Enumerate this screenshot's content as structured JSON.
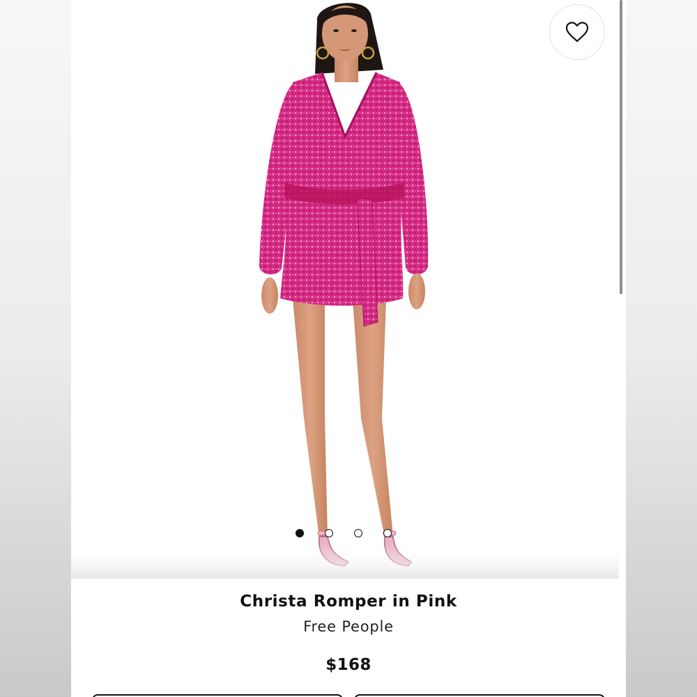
{
  "product": {
    "title": "Christa Romper in Pink",
    "brand": "Free People",
    "price": "$168"
  },
  "gallery": {
    "image_count": 4,
    "active_index": 0,
    "dress_color": "#d6247f"
  },
  "favorite": {
    "icon": "heart-outline-icon"
  },
  "colors": {
    "text_primary": "#111111",
    "background": "#ffffff"
  }
}
